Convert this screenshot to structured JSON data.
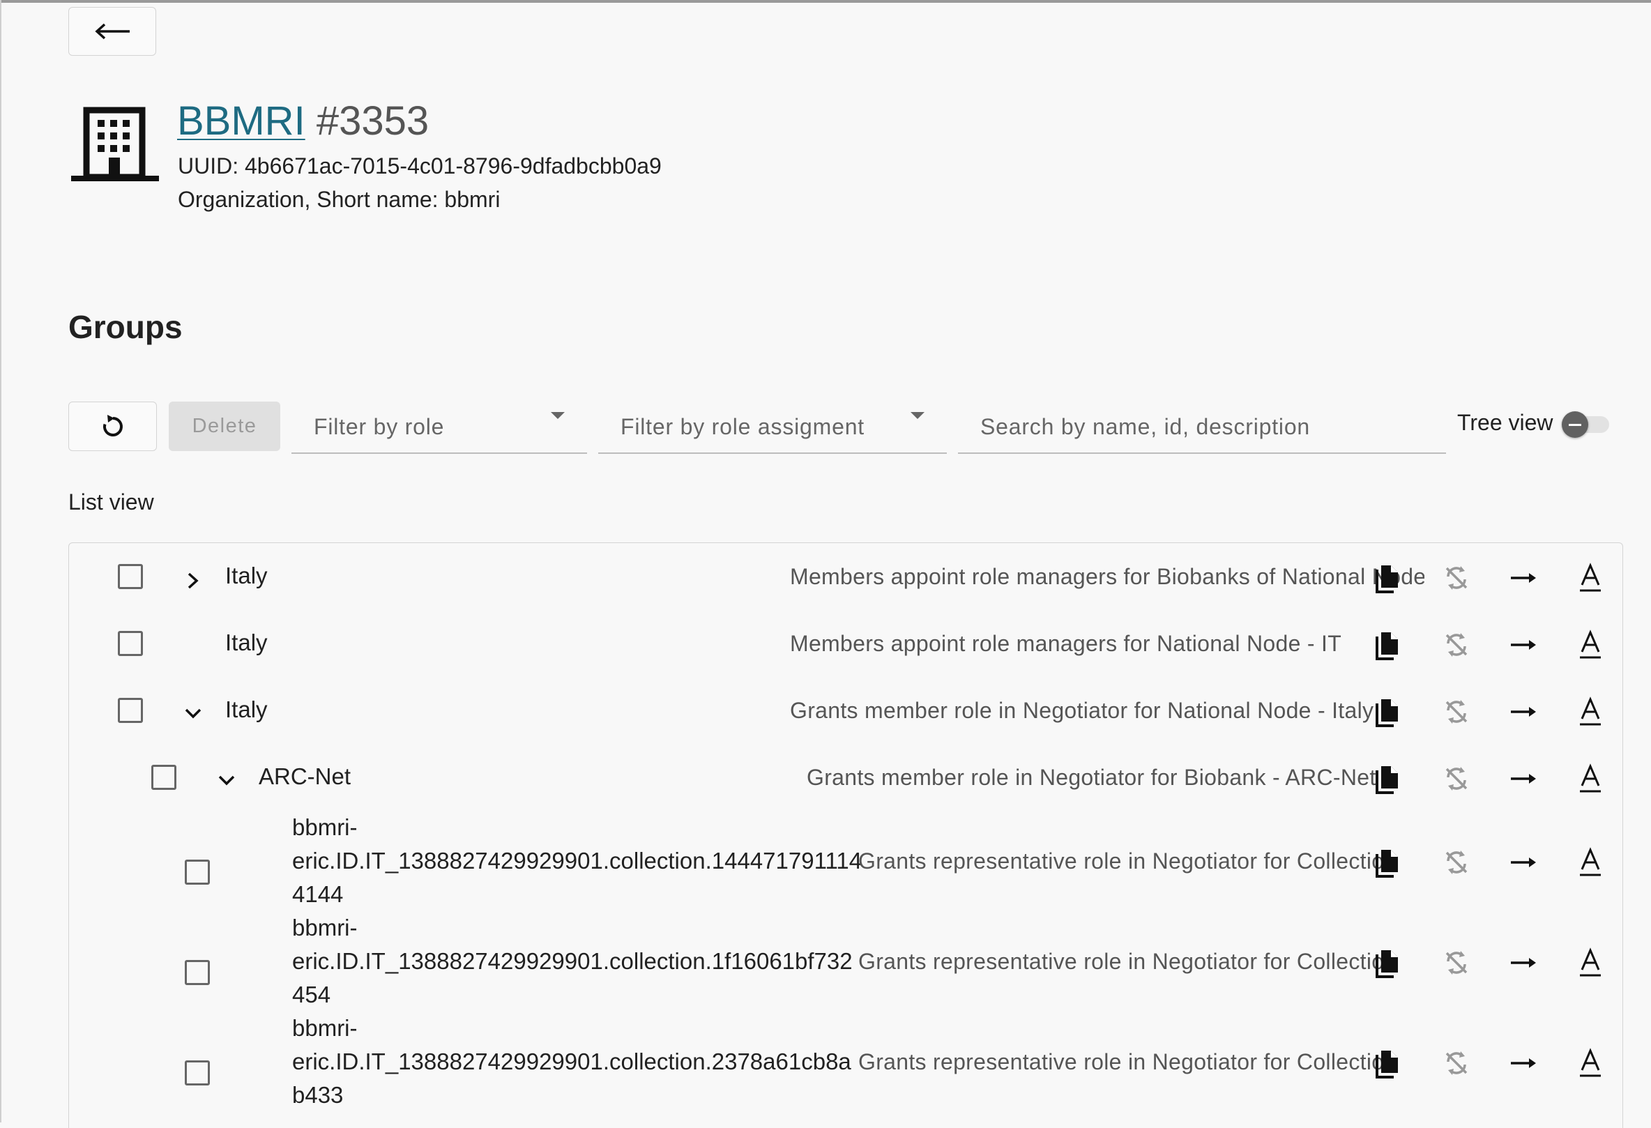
{
  "header": {
    "org_link": "BBMRI",
    "org_id": "#3353",
    "uuid": "UUID: 4b6671ac-7015-4c01-8796-9dfadbcbb0a9",
    "org_meta": "Organization, Short name: bbmri",
    "icon": "building-icon"
  },
  "groups": {
    "title": "Groups",
    "toolbar": {
      "refresh_icon": "refresh-icon",
      "delete_label": "Delete",
      "filter_role_placeholder": "Filter by role",
      "filter_assignment_placeholder": "Filter by role assigment",
      "search_placeholder": "Search by name, id, description",
      "tree_view_label": "Tree view",
      "tree_view_on": false
    },
    "view_label": "List view",
    "rows": [
      {
        "name": "Italy",
        "description": "Members appoint role managers for Biobanks of National Node - IT",
        "indent": 0,
        "expander": "collapsed"
      },
      {
        "name": "Italy",
        "description": "Members appoint role managers for National Node - IT",
        "indent": 0,
        "expander": "none"
      },
      {
        "name": "Italy",
        "description": "Grants member role in Negotiator for National Node - Italy",
        "indent": 0,
        "expander": "expanded"
      },
      {
        "name": "ARC-Net",
        "description": "Grants member role in Negotiator for Biobank - ARC-Net",
        "indent": 1,
        "expander": "expanded"
      },
      {
        "name_lines": [
          "bbmri-",
          "eric.ID.IT_1388827429929901.collection.144471791114",
          "4144"
        ],
        "description": "Grants representative role in Negotiator for Collection",
        "indent": 2
      },
      {
        "name_lines": [
          "bbmri-",
          "eric.ID.IT_1388827429929901.collection.1f16061bf732",
          "454"
        ],
        "description": "Grants representative role in Negotiator for Collection",
        "indent": 2
      },
      {
        "name_lines": [
          "bbmri-",
          "eric.ID.IT_1388827429929901.collection.2378a61cb8a",
          "b433"
        ],
        "description": "Grants representative role in Negotiator for Collection",
        "indent": 2
      }
    ],
    "row_actions": [
      "copy-icon",
      "sync-disabled-icon",
      "arrow-right-icon",
      "text-a-icon"
    ]
  }
}
